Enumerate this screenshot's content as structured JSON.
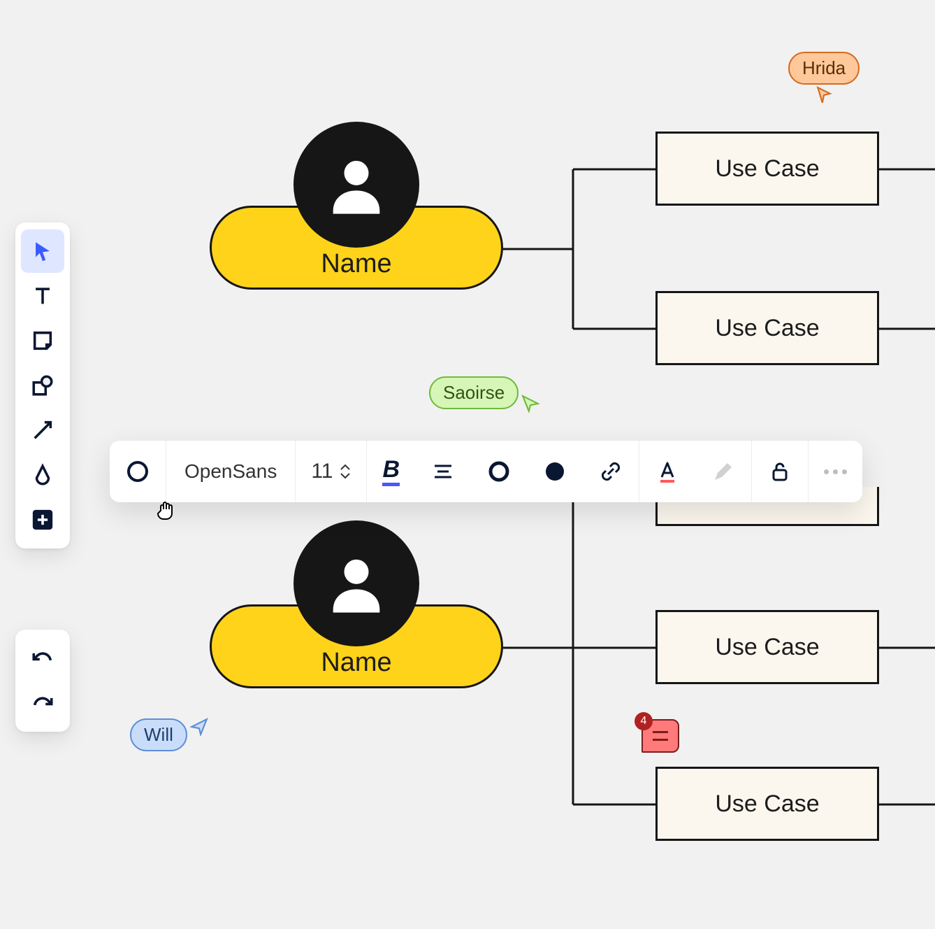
{
  "canvas": {
    "actors": [
      {
        "label": "Name"
      },
      {
        "label": "Name"
      }
    ],
    "usecases": [
      {
        "label": "Use Case"
      },
      {
        "label": "Use Case"
      },
      {
        "label": "Use Case"
      },
      {
        "label": "Use Case"
      }
    ]
  },
  "toolbar": {
    "tools": [
      {
        "name": "pointer",
        "active": true
      },
      {
        "name": "text"
      },
      {
        "name": "sticky"
      },
      {
        "name": "shapes"
      },
      {
        "name": "arrow"
      },
      {
        "name": "pen"
      },
      {
        "name": "add",
        "filled": true
      }
    ],
    "history": [
      {
        "name": "undo"
      },
      {
        "name": "redo"
      }
    ]
  },
  "format_bar": {
    "font_family": "OpenSans",
    "font_size": "11"
  },
  "presence": {
    "users": [
      {
        "name": "Hrida",
        "color": "orange"
      },
      {
        "name": "Saoirse",
        "color": "green"
      },
      {
        "name": "Will",
        "color": "blue"
      }
    ]
  },
  "comment": {
    "count": "4"
  }
}
